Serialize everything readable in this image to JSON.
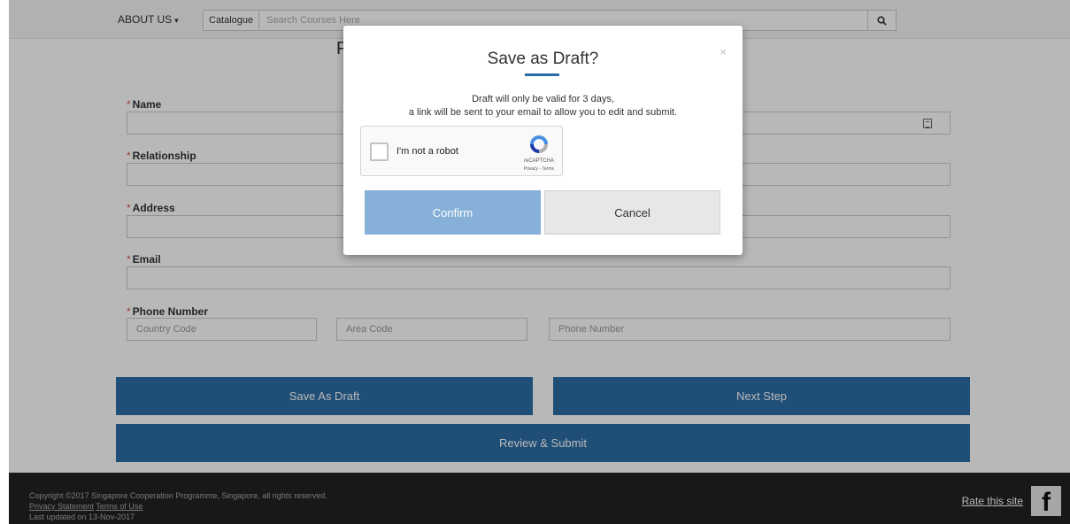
{
  "nav": {
    "about_label": "ABOUT US",
    "catalogue_label": "Catalogue",
    "search_placeholder": "Search Courses Here"
  },
  "page": {
    "title": "P"
  },
  "form": {
    "name_label": "Name",
    "relationship_label": "Relationship",
    "address_label": "Address",
    "email_label": "Email",
    "phone_label": "Phone Number",
    "required_marker": "*",
    "country_code_placeholder": "Country Code",
    "area_code_placeholder": "Area Code",
    "phone_number_placeholder": "Phone Number"
  },
  "actions": {
    "save_draft": "Save As Draft",
    "next_step": "Next Step",
    "review_submit": "Review & Submit"
  },
  "modal": {
    "title": "Save as Draft?",
    "close_glyph": "×",
    "text_line1": "Draft will only be valid for 3 days,",
    "text_line2": "a link will be sent to your email to allow you to edit and submit.",
    "captcha_text": "I'm not a robot",
    "captcha_brand": "reCAPTCHA",
    "captcha_links": "Privacy - Terms",
    "confirm_label": "Confirm",
    "cancel_label": "Cancel"
  },
  "footer": {
    "copyright": "Copyright ©2017 Singapore Cooperation Programme, Singapore, all rights reserved.",
    "privacy": "Privacy Statement",
    "terms": "Terms of Use",
    "updated": "Last updated on 13-Nov-2017",
    "rate": "Rate this site",
    "fb_glyph": "f"
  },
  "colors": {
    "primary": "#2c6ca6",
    "confirm_bg": "#86b0d8",
    "cancel_bg": "#e7e7e7",
    "footer_bg": "#222222",
    "required": "#d9534f"
  }
}
